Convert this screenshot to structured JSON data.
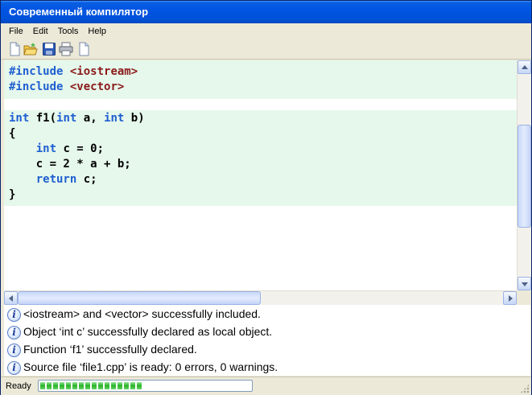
{
  "window": {
    "title": "Современный компилятор"
  },
  "menu": {
    "items": [
      "File",
      "Edit",
      "Tools",
      "Help"
    ]
  },
  "toolbar": {
    "buttons": [
      "new-file-icon",
      "open-folder-icon",
      "save-icon",
      "print-icon",
      "document-icon"
    ]
  },
  "editor": {
    "includes": [
      {
        "directive": "#include",
        "header": "<iostream>"
      },
      {
        "directive": "#include",
        "header": "<vector>"
      }
    ],
    "function": {
      "signature": {
        "type": "int",
        "name": "f1",
        "param1_type": "int",
        "param1": "a",
        "param2_type": "int",
        "param2": "b"
      },
      "open_brace": "{",
      "body": [
        {
          "kw": "int",
          "rest": " c = 0;"
        },
        {
          "kw": "",
          "rest": "c = 2 * a + b;"
        },
        {
          "kw": "return",
          "rest": " c;"
        }
      ],
      "close_brace": "}"
    },
    "highlight_color": "#e6f8ec"
  },
  "messages": [
    "<iostream> and <vector> successfully included.",
    "Object ‘int c’ successfully declared as local object.",
    "Function ‘f1’ successfully declared.",
    "Source file ‘file1.cpp’ is ready: 0 errors, 0 warnings."
  ],
  "status": {
    "text": "Ready",
    "progress_fraction": 0.5
  }
}
